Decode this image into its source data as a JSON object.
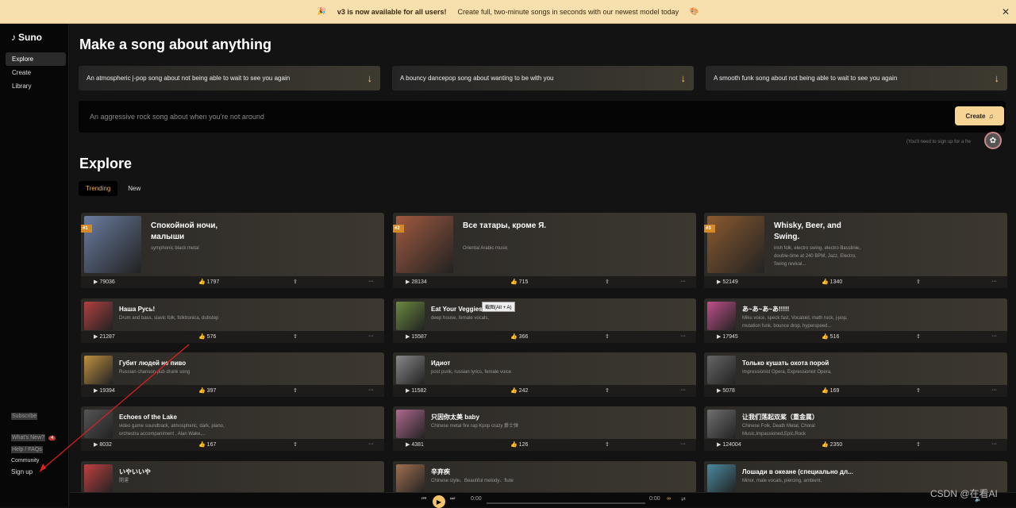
{
  "banner": {
    "emoji": "🎉",
    "strong": "v3 is now available for all users!",
    "text": "Create full, two-minute songs in seconds with our newest model today",
    "end_emoji": "🎨",
    "close": "✕"
  },
  "sidebar": {
    "logo": "Suno",
    "items": [
      {
        "label": "Explore"
      },
      {
        "label": "Create"
      },
      {
        "label": "Library"
      }
    ],
    "bottom": {
      "subscribe": "Subscribe",
      "whats_new": "What's New?",
      "whats_new_count": "4",
      "help": "Help / FAQs",
      "community": "Community",
      "signup": "Sign up"
    }
  },
  "main": {
    "heading": "Make a song about anything",
    "prompts": [
      "An atmospheric j-pop song about not being able to wait to see you again",
      "A bouncy dancepop song about wanting to be with you",
      "A smooth funk song about not being able to wait to see you again"
    ],
    "input_placeholder": "An aggressive rock song about when you're not around",
    "create_label": "Create",
    "signup_note": "(You'll need to sign up for a fre",
    "explore_heading": "Explore",
    "tabs": [
      {
        "label": "Trending"
      },
      {
        "label": "New"
      }
    ]
  },
  "tooltip": "截图(Alt + A)",
  "songs": [
    {
      "rank": "#1",
      "title": "Спокойной ночи, малыши",
      "styles": "symphonic black metal",
      "plays": "79036",
      "likes": "1797",
      "color": "#6a7ca0"
    },
    {
      "rank": "#2",
      "title": "Все татары, кроме Я.",
      "styles": "Oriental Arabic music",
      "plays": "28134",
      "likes": "715",
      "color": "#a05a40"
    },
    {
      "rank": "#3",
      "title": "Whisky, Beer, and Swing.",
      "styles": "irish folk, electro swing, electro Basslinie, double-time at 240 BPM, Jazz, Electro, Swing revival...",
      "plays": "52149",
      "likes": "1340",
      "color": "#8a5a30"
    },
    {
      "title": "Наша Русь!",
      "styles": "Drum and bass, slavic folk, folktronica, dubstep",
      "plays": "21287",
      "likes": "576",
      "color": "#b04040"
    },
    {
      "title": "Eat Your Veggies!",
      "styles": "deep house, female vocals,",
      "plays": "15587",
      "likes": "366",
      "color": "#6a8a40"
    },
    {
      "title": "あ~あ~あ~あ!!!!!",
      "styles": "Miku voice, speck fast, Vocaloid, math rock, j-pop, mutation funk, bounce drop, hyperspeed...",
      "plays": "17945",
      "likes": "516",
      "color": "#c0508a"
    },
    {
      "title": "Губит людей не пиво",
      "styles": "Russian chanson pub drunk song",
      "plays": "19394",
      "likes": "397",
      "color": "#c09040"
    },
    {
      "title": "Идиот",
      "styles": "post punk, russian lyrics, female voice",
      "plays": "11582",
      "likes": "242",
      "color": "#888888"
    },
    {
      "title": "Только кушать охота порой",
      "styles": "Impressionist Opera, Expressionist Opera,",
      "plays": "5078",
      "likes": "169",
      "color": "#666666"
    },
    {
      "title": "Echoes of the Lake",
      "styles": "video game soundtrack, atmospheric, dark, piano, orchestra accompaniment , Alan Wake,...",
      "plays": "8032",
      "likes": "167",
      "color": "#555555"
    },
    {
      "title": "只因你太美 baby",
      "styles": "Chinese metal fire rap Kpop crazy 爵士弹",
      "plays": "4381",
      "likes": "126",
      "color": "#b06a90"
    },
    {
      "title": "让我们荡起双桨（重金属）",
      "styles": "Chinese Folk, Death Metal, Choral Music,Impassioned,Epic,Rock",
      "plays": "124004",
      "likes": "2350",
      "color": "#707070"
    },
    {
      "title": "いやいいや",
      "styles": "開運",
      "plays": "",
      "likes": "",
      "color": "#c04040"
    },
    {
      "title": "辛弃疾",
      "styles": "Chinese style、Beautiful melody、flute",
      "plays": "",
      "likes": "",
      "color": "#a07050"
    },
    {
      "title": "Лошади в океане (специально дл...",
      "styles": "Minor, male vocals, piercing, ambient,",
      "plays": "",
      "likes": "",
      "color": "#4a8aa0"
    }
  ],
  "player": {
    "time_start": "0:00",
    "time_end": "0:00"
  },
  "watermark": "CSDN @在看AI"
}
